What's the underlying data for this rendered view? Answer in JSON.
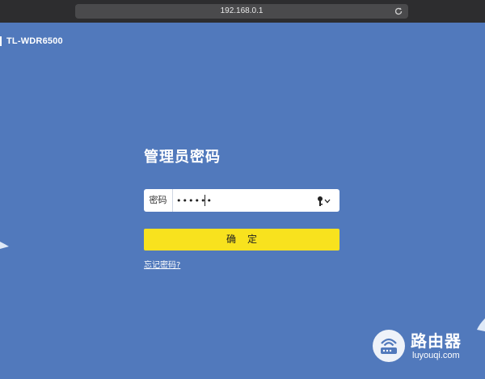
{
  "browser": {
    "address": "192.168.0.1",
    "reload_icon": "reload-icon"
  },
  "brand": {
    "title": "TL-WDR6500"
  },
  "login": {
    "heading": "管理员密码",
    "password_label": "密码",
    "password_value": "••••••",
    "key_icon": "key-icon",
    "confirm_label": "确定",
    "forgot_link": "忘记密码?"
  },
  "watermark": {
    "title": "路由器",
    "subtitle": "luyouqi.com"
  },
  "colors": {
    "background": "#5179bc",
    "confirm_button": "#f8e21e",
    "browser_chrome": "#2d2d2f"
  }
}
